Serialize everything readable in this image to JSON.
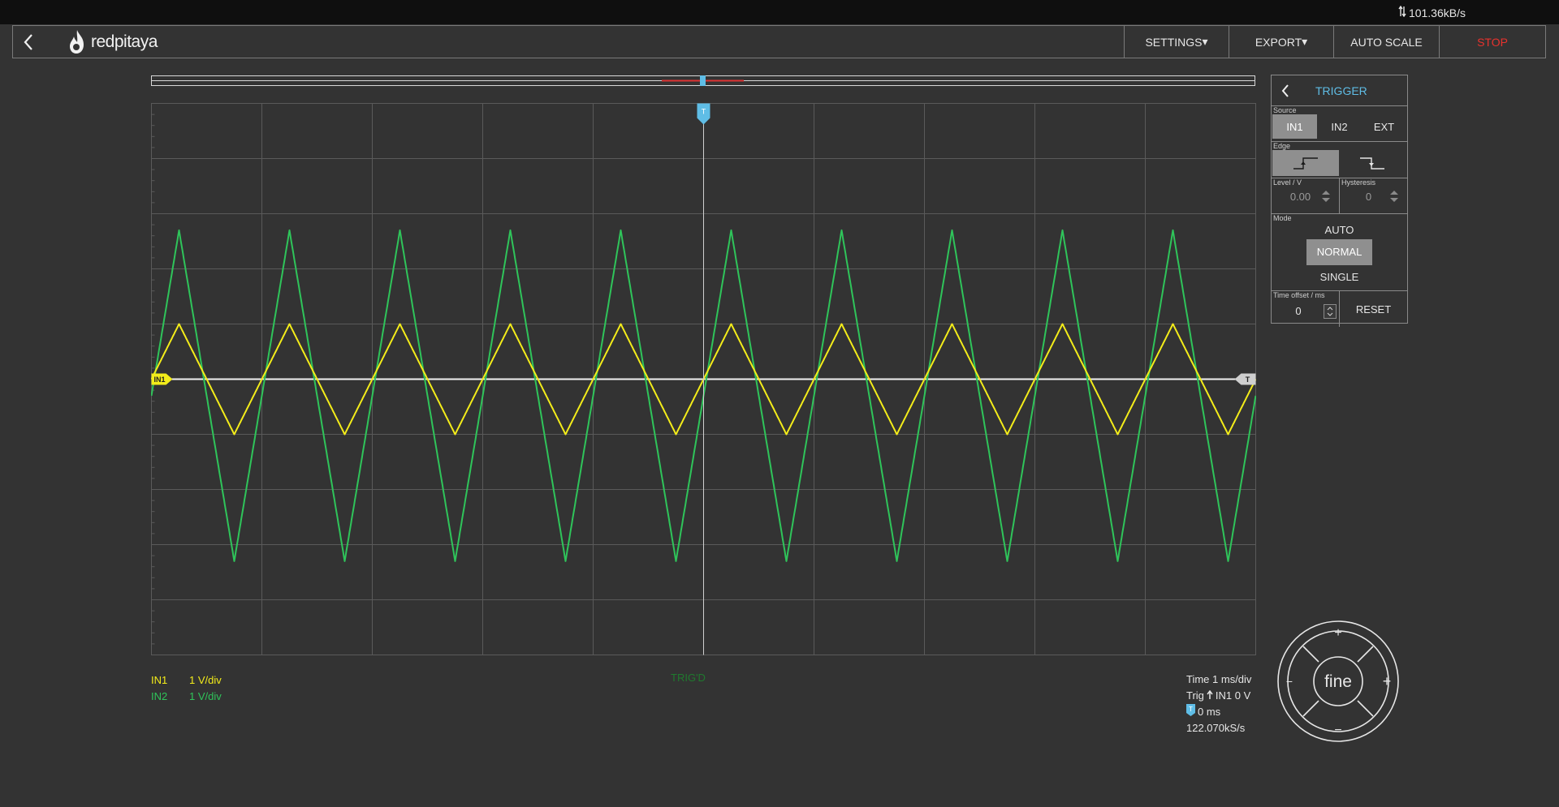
{
  "status": {
    "throughput": "101.36kB/s"
  },
  "app": {
    "logo_text": "redpitaya"
  },
  "toolbar": {
    "settings_label": "SETTINGS",
    "export_label": "EXPORT",
    "autoscale_label": "AUTO SCALE",
    "stop_label": "STOP",
    "stop_color": "#e8322d"
  },
  "colors": {
    "in1": "#f3ec1a",
    "in2": "#2fc45a",
    "trigger_marker": "#5fbde6",
    "grid": "#5a5a5a",
    "background": "#333333"
  },
  "plot": {
    "in1_marker": "IN1",
    "trigger_marker": "T",
    "level_marker": "T"
  },
  "legend": {
    "in1_name": "IN1",
    "in1_scale": "1 V/div",
    "in2_name": "IN2",
    "in2_scale": "1 V/div"
  },
  "status_text": "TRIG'D",
  "info": {
    "time": "Time 1 ms/div",
    "trig": "Trig",
    "trig_source": "IN1 0 V",
    "offset": "0 ms",
    "sample_rate": "122.070kS/s"
  },
  "trigger_panel": {
    "title": "TRIGGER",
    "source_label": "Source",
    "sources": [
      "IN1",
      "IN2",
      "EXT"
    ],
    "edge_label": "Edge",
    "level_label": "Level / V",
    "level_value": "0.00",
    "hysteresis_label": "Hysteresis",
    "hysteresis_value": "0",
    "mode_label": "Mode",
    "modes": [
      "AUTO",
      "NORMAL",
      "SINGLE"
    ],
    "time_offset_label": "Time offset / ms",
    "time_offset_value": "0",
    "reset_label": "RESET"
  },
  "wheel": {
    "center_label": "fine",
    "top": "+",
    "bottom": "−",
    "left": "−",
    "right": "+"
  },
  "chart_data": {
    "type": "line",
    "xlabel": "",
    "ylabel": "",
    "x_divisions": 10,
    "y_divisions": 10,
    "time_per_div_ms": 1,
    "volts_per_div": 1,
    "grid": true,
    "series": [
      {
        "name": "IN1",
        "waveform": "triangle",
        "period_ms": 1,
        "amplitude_v": 1,
        "offset_v": 0,
        "color": "#f3ec1a"
      },
      {
        "name": "IN2",
        "waveform": "triangle",
        "period_ms": 1,
        "amplitude_v": 3,
        "offset_v": -0.3,
        "color": "#2fc45a"
      }
    ]
  }
}
